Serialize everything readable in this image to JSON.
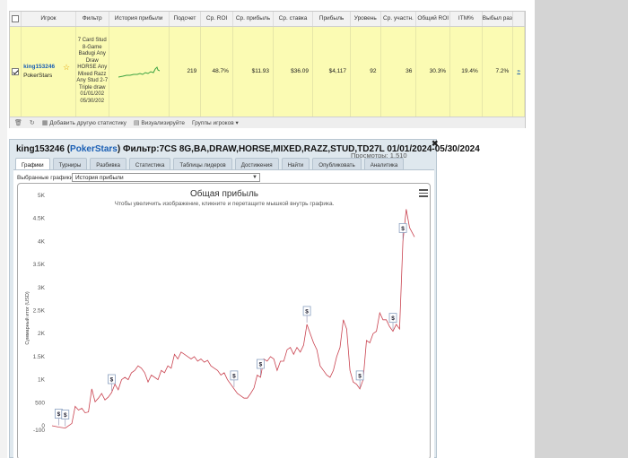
{
  "stats_table": {
    "headers": [
      "Игрок",
      "Фильтр",
      "История прибыли",
      "Подсчет",
      "Ср. ROI",
      "Ср. прибыль",
      "Ср. ставка",
      "Прибыль",
      "Уровень",
      "Ср. участн.",
      "Общий ROI",
      "ITM%",
      "Выбыл разм"
    ],
    "row": {
      "player_name": "king153246",
      "player_site": "PokerStars",
      "filter_text": "7 Card Stud 8-Game Badugi Any Draw HORSE Any Mixed Razz Any Stud 2-7 Triple draw 01/01/202 05/30/202",
      "count": "219",
      "avg_roi": "48.7%",
      "avg_profit": "$11.93",
      "avg_stake": "$36.09",
      "profit": "$4,117",
      "level": "92",
      "avg_entrants": "36",
      "total_roi": "30.3%",
      "itm": "19.4%",
      "eliminated": "7.2%",
      "expand": "»"
    },
    "footer": {
      "add_stat": "Добавить другую статистику",
      "visualize": "Визуализируйте",
      "player_groups": "Группы игроков"
    }
  },
  "panel": {
    "title_player": "king153246",
    "title_site": "PokerStars",
    "title_filter": "Фильтр:7CS 8G,BA,DRAW,HORSE,MIXED,RAZZ,STUD,TD27L 01/01/2024-05/30/2024",
    "views": "Просмотры: 1,510",
    "tabs": [
      "Графики",
      "Турниры",
      "Разбивка",
      "Статистика",
      "Таблицы лидеров",
      "Достижения",
      "Найти",
      "Опубликовать",
      "Аналитика"
    ],
    "active_tab": "Графики",
    "select_label": "Выбранные графики:",
    "select_value": "История прибыли"
  },
  "chart_data": {
    "type": "line",
    "title": "Общая прибыль",
    "subtitle": "Чтобы увеличить изображение, кликните и перетащите мышкой внутрь графика.",
    "ylabel": "Суммарный итог (USD)",
    "xlabel": "",
    "ylim": [
      -100,
      5000
    ],
    "yticks": [
      "5K",
      "4.5K",
      "4K",
      "3.5K",
      "3K",
      "2.5K",
      "2K",
      "1.5K",
      "1K",
      "500",
      "0",
      "-100"
    ],
    "ytick_values": [
      5000,
      4500,
      4000,
      3500,
      3000,
      2500,
      2000,
      1500,
      1000,
      500,
      0,
      -100
    ],
    "grid": false,
    "series_color": "#c9424f",
    "x": [
      0,
      4,
      8,
      12,
      14,
      16,
      18,
      20,
      22,
      24,
      26,
      28,
      30,
      32,
      34,
      36,
      38,
      40,
      42,
      44,
      46,
      48,
      50,
      52,
      54,
      56,
      58,
      60,
      62,
      64,
      66,
      68,
      70,
      72,
      74,
      76,
      78,
      80,
      82,
      84,
      86,
      88,
      90,
      92,
      94,
      96,
      98,
      100,
      102,
      104,
      106,
      108,
      110,
      112,
      114,
      116,
      118,
      120,
      122,
      124,
      126,
      128,
      130,
      132,
      134,
      136,
      138,
      140,
      142,
      144,
      146,
      148,
      150,
      152,
      154,
      156,
      158,
      160,
      162,
      164,
      166,
      168,
      170,
      172,
      174,
      176,
      178,
      180,
      182,
      184,
      186,
      188,
      190,
      192,
      194,
      196,
      198,
      200,
      202,
      204,
      206,
      208,
      210,
      212,
      214,
      216,
      219
    ],
    "y": [
      0,
      -30,
      -50,
      50,
      420,
      340,
      380,
      280,
      300,
      800,
      520,
      600,
      700,
      560,
      620,
      720,
      900,
      780,
      1000,
      1050,
      1000,
      1150,
      1200,
      1300,
      1250,
      1150,
      950,
      1100,
      1050,
      1000,
      1200,
      1150,
      1300,
      1250,
      1550,
      1450,
      1600,
      1550,
      1500,
      1450,
      1500,
      1400,
      1450,
      1380,
      1420,
      1300,
      1250,
      1200,
      1100,
      1150,
      1000,
      900,
      800,
      700,
      650,
      600,
      600,
      700,
      820,
      1100,
      1050,
      1450,
      1400,
      1500,
      1450,
      1200,
      1400,
      1400,
      1650,
      1700,
      1550,
      1700,
      1600,
      1750,
      2200,
      2000,
      1800,
      1650,
      1300,
      1200,
      1100,
      1050,
      1200,
      1500,
      1700,
      2300,
      2100,
      1200,
      950,
      900,
      800,
      1000,
      1850,
      1800,
      2000,
      2050,
      2450,
      2300,
      2300,
      2150,
      2050,
      2200,
      2100,
      4000,
      4700,
      4300,
      4100
    ],
    "markers_at_x": [
      4,
      10,
      36,
      110,
      127,
      155,
      186,
      207,
      213
    ]
  }
}
